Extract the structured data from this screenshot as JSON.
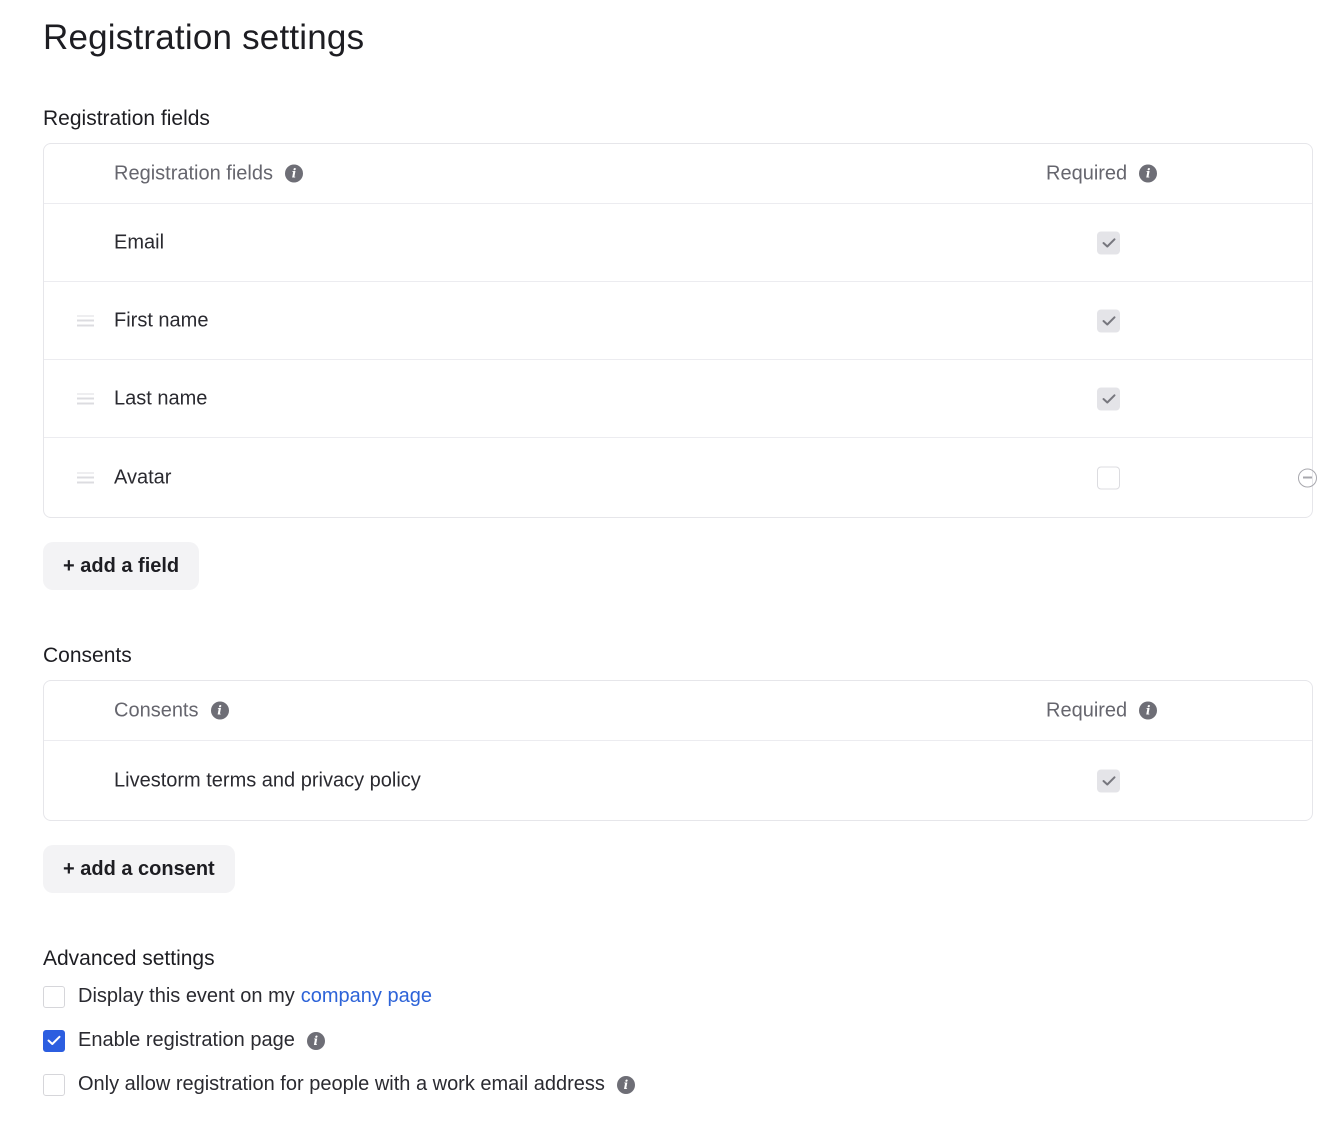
{
  "page_title": "Registration settings",
  "registration_section": {
    "title": "Registration fields",
    "header": {
      "field_label": "Registration fields",
      "required_label": "Required"
    },
    "fields": [
      {
        "label": "Email",
        "required": true,
        "draggable": false,
        "removable": false
      },
      {
        "label": "First name",
        "required": true,
        "draggable": true,
        "removable": false
      },
      {
        "label": "Last name",
        "required": true,
        "draggable": true,
        "removable": false
      },
      {
        "label": "Avatar",
        "required": false,
        "draggable": true,
        "removable": true
      }
    ],
    "add_button": "+ add a field"
  },
  "consents_section": {
    "title": "Consents",
    "header": {
      "field_label": "Consents",
      "required_label": "Required"
    },
    "items": [
      {
        "label": "Livestorm terms and privacy policy",
        "required": true
      }
    ],
    "add_button": "+ add a consent"
  },
  "advanced_section": {
    "title": "Advanced settings",
    "options": [
      {
        "label": "Display this event on my",
        "link": "company page",
        "checked": false,
        "info": false
      },
      {
        "label": "Enable registration page",
        "checked": true,
        "info": true
      },
      {
        "label": "Only allow registration for people with a work email address",
        "checked": false,
        "info": true
      }
    ]
  },
  "icons": {
    "info": "info-icon",
    "check": "check-icon",
    "drag": "drag-handle-icon",
    "remove": "remove-circle-icon"
  },
  "colors": {
    "accent": "#2c5ee0",
    "link": "#2d63d8"
  }
}
